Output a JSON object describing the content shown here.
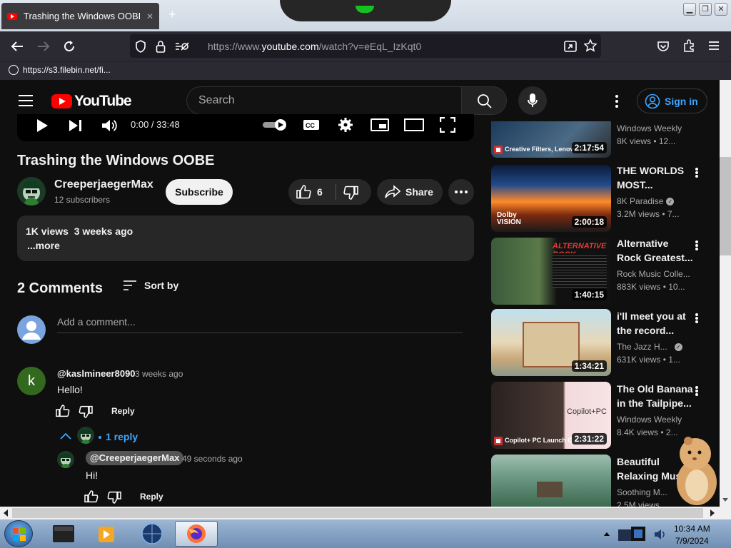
{
  "browser": {
    "tab_title": "Trashing the Windows OOBE - YouTube",
    "tab_close": "✕",
    "new_tab": "+",
    "url_prefix": "https://www.",
    "url_domain": "youtube.com",
    "url_path": "/watch?v=eEqL_IzKqt0",
    "bookmark_label": "https://s3.filebin.net/fi..."
  },
  "youtube": {
    "logo_text": "YouTube",
    "search_placeholder": "Search",
    "sign_in_label": "Sign in"
  },
  "player": {
    "time": "0:00 / 33:48"
  },
  "video": {
    "title": "Trashing the Windows OOBE",
    "channel_name": "CreeperjaegerMax",
    "subscribers": "12 subscribers",
    "subscribe_label": "Subscribe",
    "like_count": "6",
    "share_label": "Share",
    "views_date": "1K views  3 weeks ago",
    "more_label": "...more"
  },
  "comments": {
    "count_label": "2 Comments",
    "sort_label": "Sort by",
    "add_placeholder": "Add a comment...",
    "items": [
      {
        "avatar_letter": "k",
        "author": "@kaslmineer8090",
        "time": "3 weeks ago",
        "text": "Hello!",
        "reply_label": "Reply",
        "replies_label": "1 reply"
      },
      {
        "author": "@CreeperjaegerMax",
        "time": "49 seconds ago",
        "text": "Hi!",
        "reply_label": "Reply"
      }
    ]
  },
  "sidebar": {
    "videos": [
      {
        "title": "",
        "channel": "Windows Weekly",
        "meta": "8K views  • 12...",
        "duration": "2:17:54",
        "thumb_caption": "Creative Filters, Lenovo Yog"
      },
      {
        "title": "THE WORLDS MOST...",
        "channel": "8K Paradise",
        "verified": true,
        "meta": "3.2M views  • 7...",
        "duration": "2:00:18",
        "thumb_caption": "Dolby VISION"
      },
      {
        "title": "Alternative Rock Greatest...",
        "channel": "Rock Music Colle...",
        "meta": "883K views  • 10...",
        "duration": "1:40:15",
        "thumb_caption": "ALTERNATIVE ROCK"
      },
      {
        "title": "i'll meet you at the record...",
        "channel": "The Jazz H...",
        "verified": true,
        "meta": "631K views  • 1...",
        "duration": "1:34:21",
        "thumb_caption": ""
      },
      {
        "title": "The Old Banana in the Tailpipe...",
        "channel": "Windows Weekly",
        "meta": "8.4K views  • 2...",
        "duration": "2:31:22",
        "thumb_caption": "Copilot+ PC Launch Chaos &"
      },
      {
        "title": "Beautiful Relaxing Mus...",
        "channel": "Soothing M...",
        "meta": "2.5M views",
        "duration": "",
        "thumb_caption": ""
      }
    ]
  },
  "taskbar": {
    "time": "10:34 AM",
    "date": "7/9/2024"
  },
  "colors": {
    "accent": "#3ea6ff",
    "brand": "#ff0000",
    "background": "#0f0f0f"
  }
}
